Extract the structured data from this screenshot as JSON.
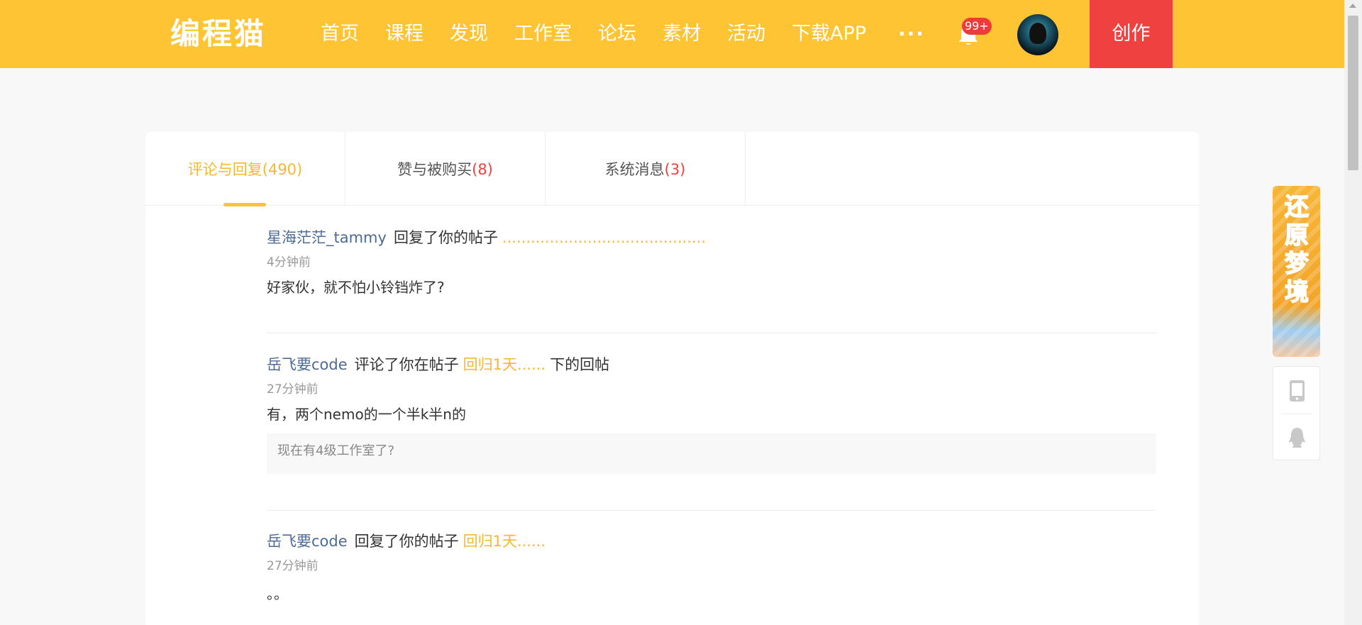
{
  "header": {
    "logo": "编程猫",
    "nav": [
      "首页",
      "课程",
      "发现",
      "工作室",
      "论坛",
      "素材",
      "活动",
      "下载APP"
    ],
    "more": "···",
    "notification_badge": "99+",
    "create_label": "创作",
    "bg_color": "#fec433",
    "create_color": "#ef4140"
  },
  "tabs": [
    {
      "label": "评论与回复",
      "count": "(490)",
      "active": true
    },
    {
      "label": "赞与被购买",
      "count": "(8)",
      "active": false
    },
    {
      "label": "系统消息",
      "count": "(3)",
      "active": false
    }
  ],
  "messages": [
    {
      "user": "星海茫茫_tammy",
      "action": "回复了你的帖子",
      "link": "...........................................",
      "suffix": "",
      "time": "4分钟前",
      "content": "好家伙，就不怕小铃铛炸了?",
      "quote": ""
    },
    {
      "user": "岳飞要code",
      "action": "评论了你在帖子",
      "link": "回归1天......",
      "suffix": "下的回帖",
      "time": "27分钟前",
      "content": "有，两个nemo的一个半k半n的",
      "quote": "现在有4级工作室了?"
    },
    {
      "user": "岳飞要code",
      "action": "回复了你的帖子",
      "link": "回归1天......",
      "suffix": "",
      "time": "27分钟前",
      "content": "。。",
      "quote": ""
    }
  ],
  "side": {
    "ad_text": "还原梦境",
    "icons": [
      "phone-icon",
      "qq-penguin-icon"
    ]
  }
}
